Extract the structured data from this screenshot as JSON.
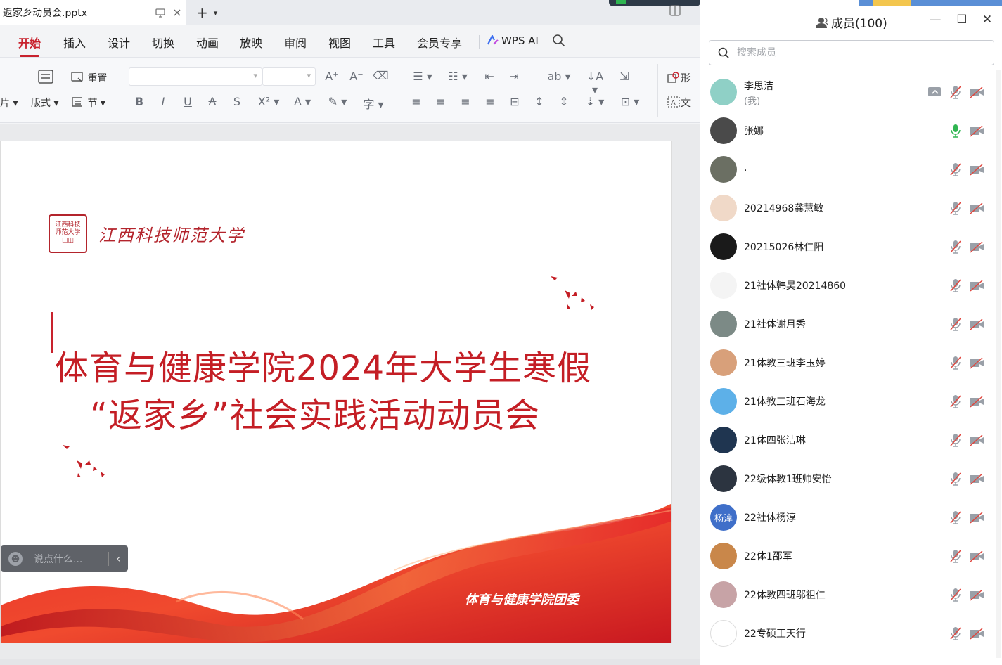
{
  "doc": {
    "tab_title": "返家乡动员会.pptx"
  },
  "menu": [
    {
      "label": "开始",
      "active": true
    },
    {
      "label": "插入"
    },
    {
      "label": "设计"
    },
    {
      "label": "切换"
    },
    {
      "label": "动画"
    },
    {
      "label": "放映"
    },
    {
      "label": "审阅"
    },
    {
      "label": "视图"
    },
    {
      "label": "工具"
    },
    {
      "label": "会员专享"
    },
    {
      "label": "WPS AI"
    }
  ],
  "ribbon": {
    "picture_tail": "片",
    "layout": "版式",
    "reset": "重置",
    "section": "节",
    "shape_tail": "形",
    "textbox_tail": "文"
  },
  "slide": {
    "title_line1": "体育与健康学院2024年大学生寒假",
    "title_line2": "“返家乡”社会实践活动动员会",
    "footer": "体育与健康学院团委",
    "accent_color": "#c41e25"
  },
  "chat": {
    "placeholder": "说点什么..."
  },
  "members_panel": {
    "title": "成员(100)",
    "search_placeholder": "搜索成员",
    "members": [
      {
        "name": "李思洁",
        "sub": "(我)",
        "sharing": true,
        "mic": "muted",
        "cam": "off",
        "avatar_color": "#8fd0c6"
      },
      {
        "name": "张娜",
        "mic": "active",
        "cam": "off",
        "avatar_color": "#4a4a4a"
      },
      {
        "name": ".",
        "mic": "muted",
        "cam": "off",
        "avatar_color": "#6b6f63"
      },
      {
        "name": "20214968龚慧敏",
        "mic": "muted",
        "cam": "off",
        "avatar_color": "#f0d9c8"
      },
      {
        "name": "20215026林仁阳",
        "mic": "muted",
        "cam": "off",
        "avatar_color": "#1a1a1a"
      },
      {
        "name": "21社体韩昊20214860",
        "mic": "muted",
        "cam": "off",
        "avatar_color": "#f4f4f4"
      },
      {
        "name": "21社体谢月秀",
        "mic": "muted",
        "cam": "off",
        "avatar_color": "#7c8a86"
      },
      {
        "name": "21体教三班李玉婷",
        "mic": "muted",
        "cam": "off",
        "avatar_color": "#d8a07a"
      },
      {
        "name": "21体教三班石海龙",
        "mic": "muted",
        "cam": "off",
        "avatar_color": "#5db0e8"
      },
      {
        "name": "21体四张洁琳",
        "mic": "muted",
        "cam": "off",
        "avatar_color": "#1f3550"
      },
      {
        "name": "22级体教1班帅安怡",
        "mic": "muted",
        "cam": "off",
        "avatar_color": "#2c3440"
      },
      {
        "name": "22社体杨淳",
        "avatar_text": "杨淳",
        "mic": "muted",
        "cam": "off",
        "avatar_color": "#3f6fc9"
      },
      {
        "name": "22体1邵军",
        "mic": "muted",
        "cam": "off",
        "avatar_color": "#c9874a"
      },
      {
        "name": "22体教四班邬祖仁",
        "mic": "muted",
        "cam": "off",
        "avatar_color": "#c7a3a6"
      },
      {
        "name": "22专硕王天行",
        "mic": "muted",
        "cam": "off",
        "avatar_color": "#ffffff"
      }
    ]
  },
  "colors": {
    "mic_active": "#2fb551",
    "muted_icon": "#9aa0a8",
    "wps_accent": "#c8222d"
  }
}
